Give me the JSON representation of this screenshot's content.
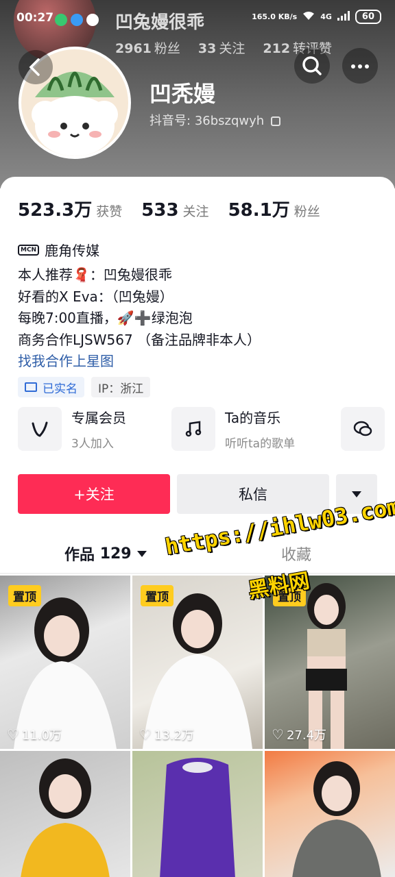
{
  "status_bar": {
    "time": "00:27",
    "speed": "165.0",
    "speed_unit": "KB/s",
    "network": "4G",
    "battery": "60"
  },
  "header_ghost": {
    "title": "凹兔嫚很乖",
    "fans": "2961",
    "fans_label": "粉丝",
    "following": "33",
    "following_label": "关注",
    "reposts": "212",
    "reposts_label": "转评赞"
  },
  "profile": {
    "name": "凹秃嫚",
    "douyin_id_label": "抖音号:",
    "douyin_id": "36bszqwyh"
  },
  "stats": [
    {
      "value": "523.3万",
      "label": "获赞"
    },
    {
      "value": "533",
      "label": "关注"
    },
    {
      "value": "58.1万",
      "label": "粉丝"
    }
  ],
  "mcn": {
    "badge": "MCN",
    "name": "鹿角传媒"
  },
  "bio": {
    "line1": "本人推荐🧣：凹兔嫚很乖",
    "line2": "好看的X Eva：（凹兔嫚）",
    "line3": "每晚7:00直播，🚀➕绿泡泡",
    "line4": "商务合作LJSW567  （备注品牌非本人）",
    "link": "找我合作上星图"
  },
  "tags": {
    "verified": "已实名",
    "ip": "IP：浙江"
  },
  "features": [
    {
      "title": "专属会员",
      "subtitle": "3人加入",
      "icon": "v-logo-icon"
    },
    {
      "title": "Ta的音乐",
      "subtitle": "听听ta的歌单",
      "icon": "music-note-icon"
    },
    {
      "title": "",
      "subtitle": "",
      "icon": "chat-bubble-icon"
    }
  ],
  "buttons": {
    "follow": "+关注",
    "message": "私信"
  },
  "tabs": {
    "works_label": "作品",
    "works_count": "129",
    "favorites": "收藏"
  },
  "videos": [
    {
      "pinned": "置顶",
      "likes": "11.0万"
    },
    {
      "pinned": "置顶",
      "likes": "13.2万"
    },
    {
      "pinned": "置顶",
      "likes": "27.4万"
    },
    {
      "pinned": "",
      "likes": ""
    },
    {
      "pinned": "",
      "likes": ""
    },
    {
      "pinned": "",
      "likes": ""
    }
  ],
  "watermark": {
    "url": "https://ihlw03.com",
    "text": "黑料网"
  },
  "colors": {
    "follow_button": "#fe2c55",
    "pin_badge": "#ffcc1f",
    "link": "#2f5ea8",
    "verified": "#2f6bd6"
  }
}
